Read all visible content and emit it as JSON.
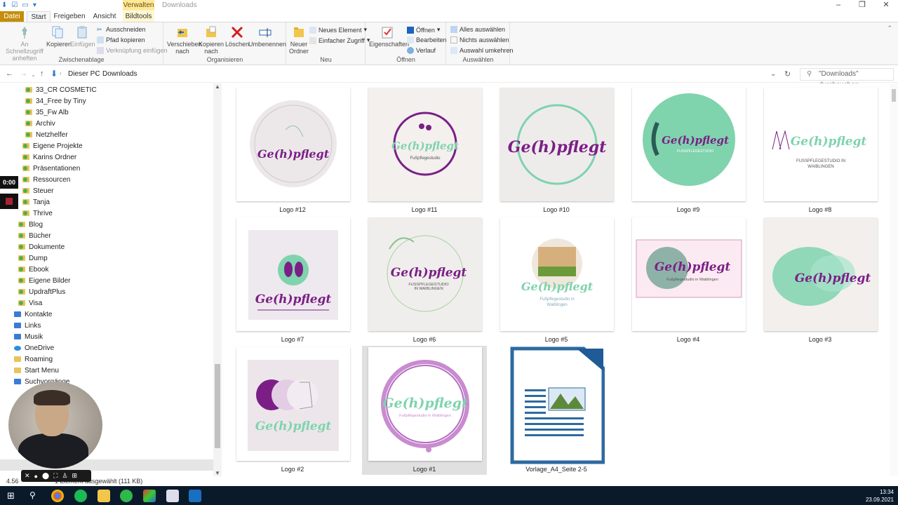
{
  "window": {
    "contextual_tab": "Verwalten",
    "title": "Downloads",
    "controls": [
      "–",
      "❐",
      "✕"
    ]
  },
  "tabs": [
    {
      "label": "Datei"
    },
    {
      "label": "Start"
    },
    {
      "label": "Freigeben"
    },
    {
      "label": "Ansicht"
    },
    {
      "label": "Bildtools"
    }
  ],
  "ribbon": {
    "clipboard": {
      "label": "Zwischenablage",
      "pin": "An Schnellzugriff anheften",
      "copy": "Kopieren",
      "paste": "Einfügen",
      "cut": "Ausschneiden",
      "copy_path": "Pfad kopieren",
      "paste_shortcut": "Verknüpfung einfügen"
    },
    "organize": {
      "label": "Organisieren",
      "move_to": "Verschieben nach",
      "copy_to": "Kopieren nach",
      "delete": "Löschen",
      "rename": "Umbenennen"
    },
    "new": {
      "label": "Neu",
      "new_folder": "Neuer Ordner",
      "new_item": "Neues Element",
      "easy_access": "Einfacher Zugriff"
    },
    "open": {
      "label": "Öffnen",
      "properties": "Eigenschaften",
      "open": "Öffnen",
      "edit": "Bearbeiten",
      "history": "Verlauf"
    },
    "select": {
      "label": "Auswählen",
      "select_all": "Alles auswählen",
      "select_none": "Nichts auswählen",
      "invert": "Auswahl umkehren"
    }
  },
  "address": {
    "crumbs": [
      "Dieser PC",
      "Downloads"
    ],
    "search_placeholder": "\"Downloads\" durchsuchen"
  },
  "sidebar": {
    "items": [
      {
        "label": "33_CR COSMETIC",
        "icon": "folder-green",
        "indent": 2
      },
      {
        "label": "34_Free by Tiny",
        "icon": "folder-green",
        "indent": 2
      },
      {
        "label": "35_Fw Alb",
        "icon": "folder-green",
        "indent": 2
      },
      {
        "label": "Archiv",
        "icon": "folder-green",
        "indent": 2
      },
      {
        "label": "Netzhelfer",
        "icon": "folder-green",
        "indent": 2
      },
      {
        "label": "Eigene Projekte",
        "icon": "folder-green",
        "indent": 1
      },
      {
        "label": "Karins Ordner",
        "icon": "folder-green",
        "indent": 1
      },
      {
        "label": "Präsentationen",
        "icon": "folder-green",
        "indent": 1
      },
      {
        "label": "Ressourcen",
        "icon": "folder-green",
        "indent": 1
      },
      {
        "label": "Steuer",
        "icon": "folder-green",
        "indent": 1
      },
      {
        "label": "Tanja",
        "icon": "folder-green",
        "indent": 1
      },
      {
        "label": "Thrive",
        "icon": "folder-green",
        "indent": 1
      },
      {
        "label": "Blog",
        "icon": "folder-green",
        "indent": 0
      },
      {
        "label": "Bücher",
        "icon": "folder-green",
        "indent": 0
      },
      {
        "label": "Dokumente",
        "icon": "folder-green",
        "indent": 0
      },
      {
        "label": "Dump",
        "icon": "folder-green",
        "indent": 0
      },
      {
        "label": "Ebook",
        "icon": "folder-green",
        "indent": 0
      },
      {
        "label": "Eigene Bilder",
        "icon": "folder-green",
        "indent": 0
      },
      {
        "label": "UpdraftPlus",
        "icon": "folder-green",
        "indent": 0
      },
      {
        "label": "Visa",
        "icon": "folder-green",
        "indent": 0
      },
      {
        "label": "Kontakte",
        "icon": "contacts",
        "indent": -1
      },
      {
        "label": "Links",
        "icon": "links",
        "indent": -1
      },
      {
        "label": "Musik",
        "icon": "music",
        "indent": -1
      },
      {
        "label": "OneDrive",
        "icon": "cloud",
        "indent": -1
      },
      {
        "label": "Roaming",
        "icon": "folder",
        "indent": -1
      },
      {
        "label": "Start Menu",
        "icon": "folder",
        "indent": -1
      },
      {
        "label": "Suchvorgänge",
        "icon": "search",
        "indent": -1
      }
    ]
  },
  "files": [
    {
      "name": "Logo #12",
      "style": "circle-grey"
    },
    {
      "name": "Logo #11",
      "style": "ring-purple"
    },
    {
      "name": "Logo #10",
      "style": "ring-mint"
    },
    {
      "name": "Logo #9",
      "style": "mint-disc"
    },
    {
      "name": "Logo #8",
      "style": "white-text"
    },
    {
      "name": "Logo #7",
      "style": "square-feet"
    },
    {
      "name": "Logo #6",
      "style": "green-outline"
    },
    {
      "name": "Logo #5",
      "style": "feet-photo"
    },
    {
      "name": "Logo #4",
      "style": "pink-banner"
    },
    {
      "name": "Logo #3",
      "style": "watercolor"
    },
    {
      "name": "Logo #2",
      "style": "dots"
    },
    {
      "name": "Logo #1",
      "style": "brush-ring",
      "selected": true
    },
    {
      "name": "Vorlage_A4_Seite 2-5",
      "style": "odt"
    }
  ],
  "logo_text": "Ge(h)pflegt",
  "status": {
    "count": "4.56",
    "selection": "1 Element ausgewählt (111 KB)"
  },
  "overlay": {
    "timer": "0:00"
  },
  "taskbar": {
    "time": "13:34",
    "date": "23.09.2021"
  },
  "colors": {
    "purple": "#7b1f86",
    "mint": "#7fd3ad",
    "file_tab": "#c48d0a"
  }
}
